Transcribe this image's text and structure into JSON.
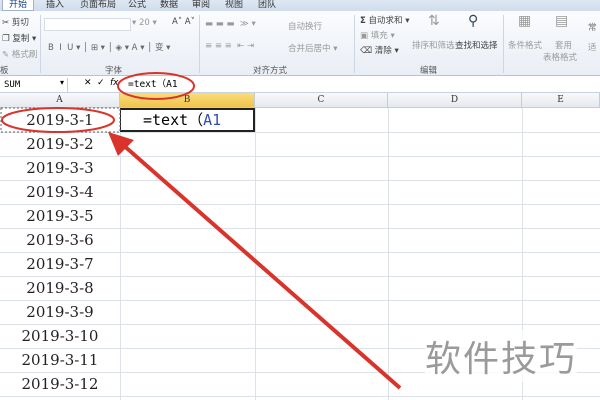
{
  "tabs": [
    "开始",
    "插入",
    "页面布局",
    "公式",
    "数据",
    "审阅",
    "视图",
    "团队"
  ],
  "clipboard": {
    "cut": "剪切",
    "copy": "复制",
    "format_painter": "格式刷",
    "group": "板"
  },
  "font": {
    "size": "20",
    "group": "字体"
  },
  "alignment": {
    "wrap": "自动换行",
    "merge": "合并后居中",
    "group": "对齐方式"
  },
  "editing": {
    "autosum": "自动求和",
    "fill": "填充",
    "clear": "清除",
    "sort": "排序和筛选",
    "find": "查找和选择",
    "group": "编辑"
  },
  "styles": {
    "conditional": "条件格式",
    "table_format_1": "套用",
    "table_format_2": "表格格式",
    "normal": "常",
    "apply": "适"
  },
  "formula_bar": {
    "name_box": "SUM",
    "formula": "=text（A1",
    "fx": "fx"
  },
  "columns": [
    "A",
    "B",
    "C",
    "D",
    "E"
  ],
  "cells_a": [
    "2019-3-1",
    "2019-3-2",
    "2019-3-3",
    "2019-3-4",
    "2019-3-5",
    "2019-3-6",
    "2019-3-7",
    "2019-3-8",
    "2019-3-9",
    "2019-3-10",
    "2019-3-11",
    "2019-3-12"
  ],
  "b1": {
    "prefix": "=text（",
    "ref": "A1"
  },
  "watermark": "软件技巧",
  "colors": {
    "annotation": "#d9342b",
    "ref": "#2d4fb3",
    "selected_header": "#f1c34c"
  }
}
